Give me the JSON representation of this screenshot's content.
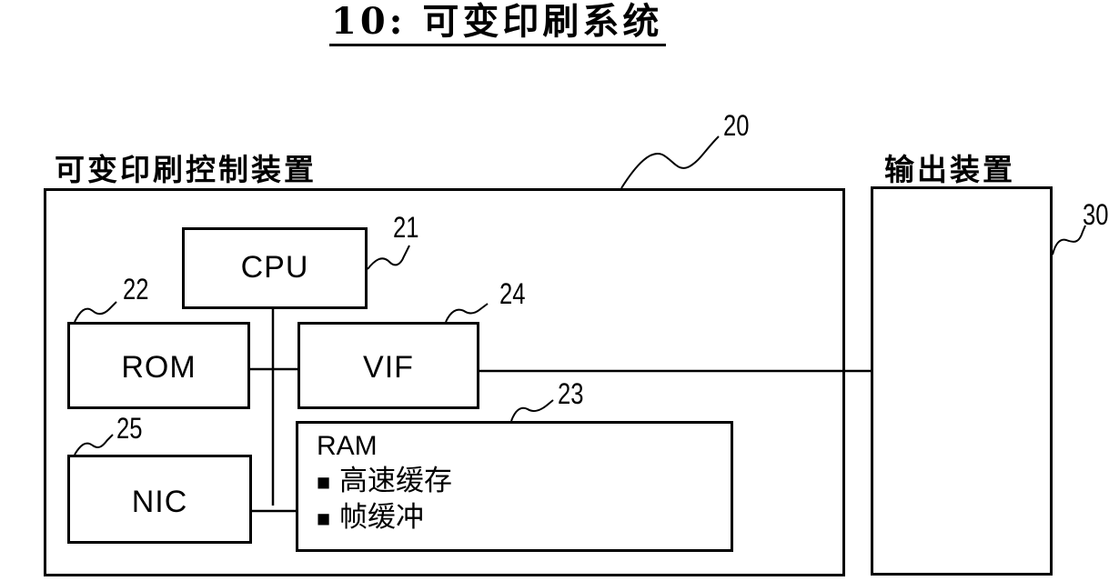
{
  "title": "10: 可变印刷系统",
  "control_device": {
    "label": "可变印刷控制装置",
    "ref": "20",
    "components": {
      "cpu": {
        "label": "CPU",
        "ref": "21"
      },
      "rom": {
        "label": "ROM",
        "ref": "22"
      },
      "vif": {
        "label": "VIF",
        "ref": "24"
      },
      "ram": {
        "label": "RAM",
        "ref": "23",
        "items": [
          "高速缓存",
          "帧缓冲"
        ]
      },
      "nic": {
        "label": "NIC",
        "ref": "25"
      }
    }
  },
  "output_device": {
    "label": "输出装置",
    "ref": "30"
  }
}
